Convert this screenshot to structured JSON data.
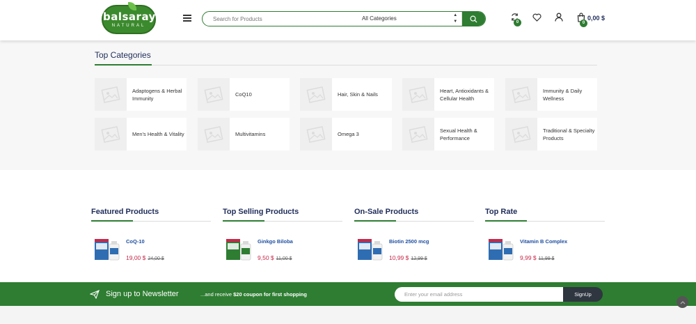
{
  "header": {
    "logo_text": "balsarayı",
    "logo_sub": "NATURAL",
    "search_placeholder": "Search for Products",
    "category_select": "All Categories",
    "compare_count": "0",
    "cart_count": "0",
    "cart_total": "0,00 $",
    "icons": [
      "menu-icon",
      "search-icon",
      "compare-icon",
      "heart-icon",
      "user-icon",
      "cart-icon"
    ]
  },
  "categories": {
    "title": "Top Categories",
    "items": [
      {
        "label": "Adaptogens & Herbal Immunity"
      },
      {
        "label": "CoQ10"
      },
      {
        "label": "Hair, Skin & Nails"
      },
      {
        "label": "Heart, Antioxidants & Cellular Health"
      },
      {
        "label": "Immunity & Daily Wellness"
      },
      {
        "label": "Men's Health & Vitality"
      },
      {
        "label": "Multivitamins"
      },
      {
        "label": "Omega 3"
      },
      {
        "label": "Sexual Health & Performance"
      },
      {
        "label": "Traditional & Specialty Products"
      }
    ]
  },
  "products": [
    {
      "title": "Featured Products",
      "name": "CoQ-10",
      "price": "19,00 $",
      "old_price": "24,00 $",
      "box_color": "#2f6db3"
    },
    {
      "title": "Top Selling Products",
      "name": "Ginkgo Biloba",
      "price": "9,50 $",
      "old_price": "11,00 $",
      "box_color": "#2e7d32"
    },
    {
      "title": "On-Sale Products",
      "name": "Biotin 2500 mcg",
      "price": "10,99 $",
      "old_price": "12,99 $",
      "box_color": "#2f6db3"
    },
    {
      "title": "Top Rate",
      "name": "Vitamin B Complex",
      "price": "9,99 $",
      "old_price": "11,99 $",
      "box_color": "#2f6db3"
    }
  ],
  "newsletter": {
    "title": "Sign up to Newsletter",
    "text_prefix": "...and receive ",
    "text_bold": "$20 coupon for first shopping",
    "input_placeholder": "Enter your email address",
    "button_label": "SignUp"
  },
  "colors": {
    "primary": "#2e7d32",
    "navy": "#1f2d5a",
    "price": "#c62848",
    "link": "#1f4fa0"
  }
}
